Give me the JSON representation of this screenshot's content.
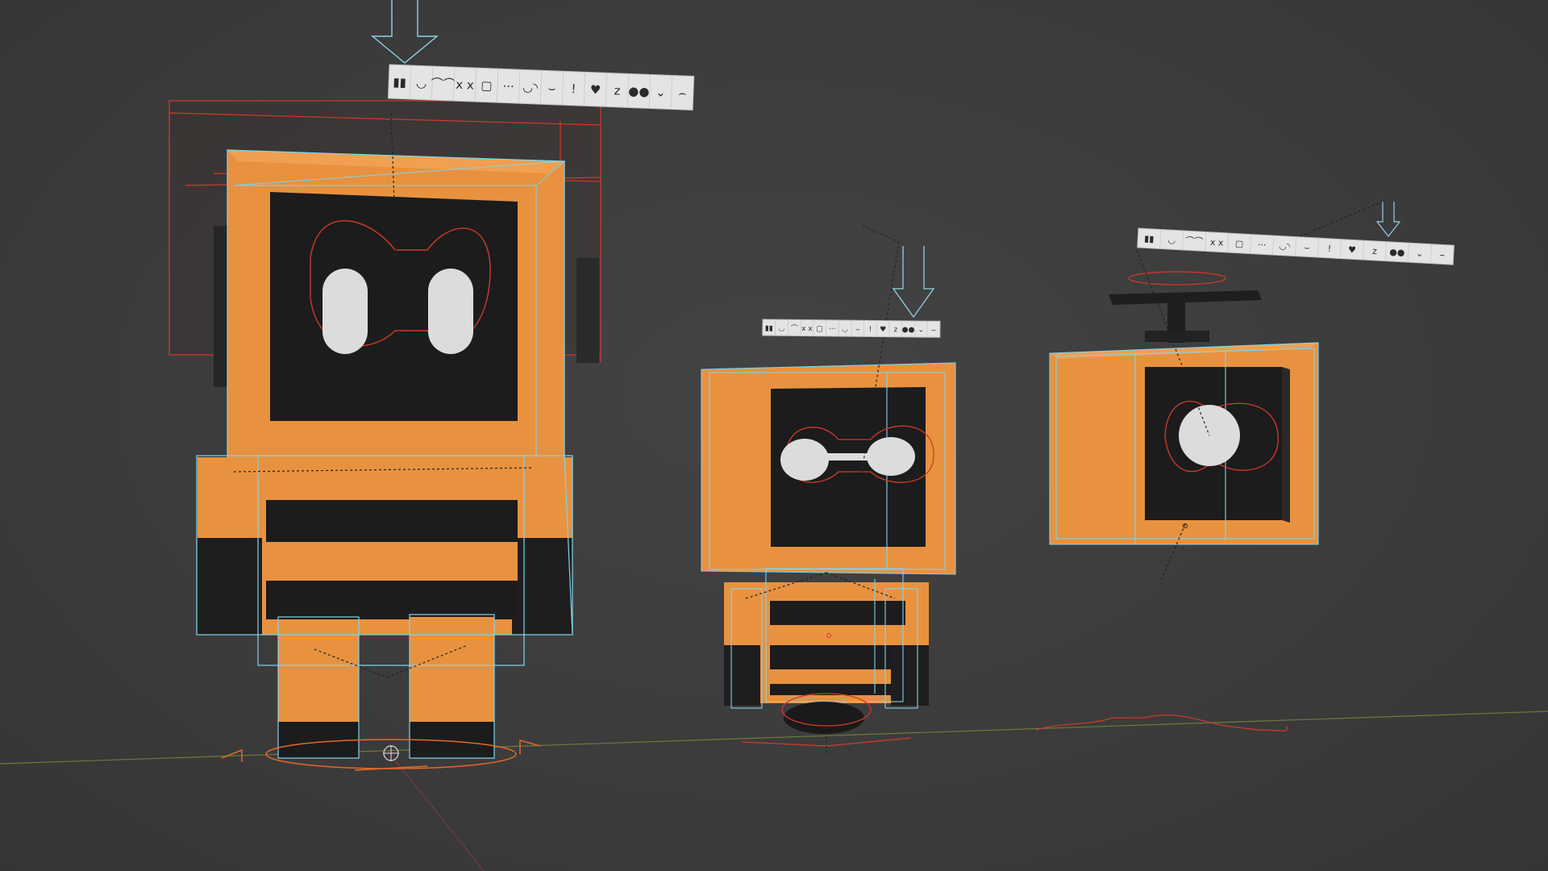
{
  "viewport": {
    "name": "3D Viewport",
    "background_color": "#3d3d3d",
    "floor_grid": true
  },
  "colors": {
    "body_orange": "#e8923f",
    "body_orange_dark": "#c47530",
    "screen_black": "#1c1c1c",
    "eye_white": "#dcdcdc",
    "selection_outline": "#7fd4ee",
    "rig_outline": "#d03a28",
    "control_orange": "#e06a28",
    "strip_paper": "#e4e4e4",
    "strip_ink": "#2a2a2a"
  },
  "objects": [
    {
      "name": "robot-large",
      "icon": "screen-head-robot",
      "state": "selected"
    },
    {
      "name": "robot-medium",
      "icon": "screen-head-robot",
      "state": "selected"
    },
    {
      "name": "robot-head-propeller",
      "icon": "propeller-box-head",
      "state": "selected"
    }
  ],
  "expression_strips": [
    {
      "name": "expression-strip-large",
      "glyphs": [
        "▮▮",
        "◟◞",
        "⌒⌒",
        "x x",
        "▢",
        "···",
        "◡◝",
        "⌣",
        "!",
        "♥",
        "z",
        "●●",
        "⌄",
        "⌢"
      ]
    },
    {
      "name": "expression-strip-medium",
      "glyphs": [
        "▮▮",
        "◟◞",
        "⌒",
        "x x",
        "▢",
        "···",
        "◡",
        "⌣",
        "!",
        "♥",
        "z",
        "●●",
        "⌄",
        "⌢"
      ]
    },
    {
      "name": "expression-strip-small",
      "glyphs": [
        "▮▮",
        "◟◞",
        "⌒⌒",
        "x x",
        "▢",
        "···",
        "◡◝",
        "⌣",
        "!",
        "♥",
        "z",
        "●●",
        "⌄",
        "⌢"
      ]
    }
  ]
}
